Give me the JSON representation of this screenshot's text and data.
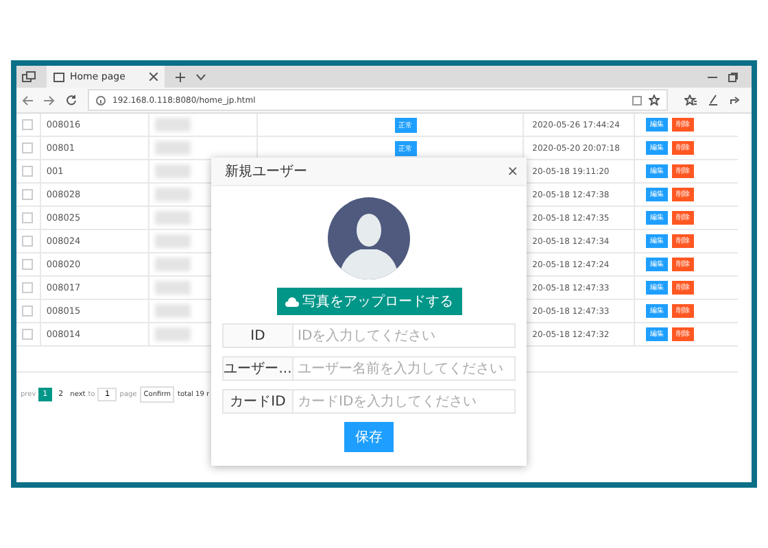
{
  "browser": {
    "tab_title": "Home page",
    "url": "192.168.0.118:8080/home_jp.html"
  },
  "table": {
    "rows": [
      {
        "checked": false,
        "id": "008016",
        "status": "正常",
        "date": "2020-05-26 17:44:24",
        "edit": "編集",
        "delete": "削除"
      },
      {
        "checked": false,
        "id": "00801",
        "status": "正常",
        "date": "2020-05-20 20:07:18",
        "edit": "編集",
        "delete": "削除"
      },
      {
        "checked": false,
        "id": "001",
        "date": "20-05-18 19:11:20",
        "edit": "編集",
        "delete": "削除"
      },
      {
        "checked": false,
        "id": "008028",
        "date": "20-05-18 12:47:38",
        "edit": "編集",
        "delete": "削除"
      },
      {
        "checked": false,
        "id": "008025",
        "date": "20-05-18 12:47:35",
        "edit": "編集",
        "delete": "削除"
      },
      {
        "checked": false,
        "id": "008024",
        "date": "20-05-18 12:47:34",
        "edit": "編集",
        "delete": "削除"
      },
      {
        "checked": false,
        "id": "008020",
        "date": "20-05-18 12:47:24",
        "edit": "編集",
        "delete": "削除"
      },
      {
        "checked": false,
        "id": "008017",
        "date": "20-05-18 12:47:33",
        "edit": "編集",
        "delete": "削除"
      },
      {
        "checked": false,
        "id": "008015",
        "date": "20-05-18 12:47:33",
        "edit": "編集",
        "delete": "削除"
      },
      {
        "checked": false,
        "id": "008014",
        "date": "20-05-18 12:47:32",
        "edit": "編集",
        "delete": "削除"
      }
    ]
  },
  "pagination": {
    "prev": "prev",
    "pages": [
      {
        "label": "1",
        "selected": true
      },
      {
        "label": "2",
        "selected": false
      }
    ],
    "next": "next",
    "to": "to",
    "page_value": "1",
    "page": "page",
    "confirm": "Confirm",
    "total": "total 19 r"
  },
  "dialog": {
    "title": "新規ユーザー",
    "close": "×",
    "upload": "写真をアップロードする",
    "fields": [
      {
        "label": "ID",
        "placeholder": "IDを入力してください"
      },
      {
        "label": "ユーザー...",
        "placeholder": "ユーザー名前を入力してください"
      },
      {
        "label": "カードID",
        "placeholder": "カードIDを入力してください"
      }
    ],
    "save": "保存"
  }
}
